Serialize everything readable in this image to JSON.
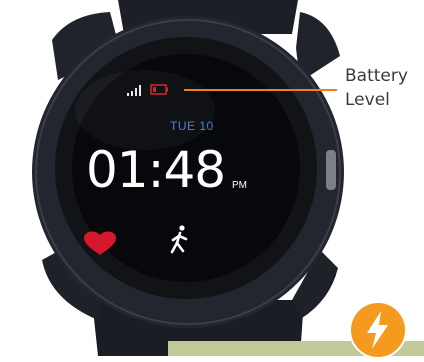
{
  "annotation": {
    "line1": "Battery",
    "line2": "Level"
  },
  "watch": {
    "date": "TUE 10",
    "time": "01:48",
    "ampm": "PM"
  },
  "colors": {
    "accent_line": "#ef7d22",
    "battery_icon": "#c42a2a",
    "heart_icon": "#d8172c",
    "date_text": "#4f7de0",
    "lightning_badge": "#f49a1e",
    "footer_box": "#c2c998"
  },
  "icons": [
    "signal-icon",
    "battery-icon",
    "heart-icon",
    "walking-figure-icon",
    "lightning-icon"
  ]
}
